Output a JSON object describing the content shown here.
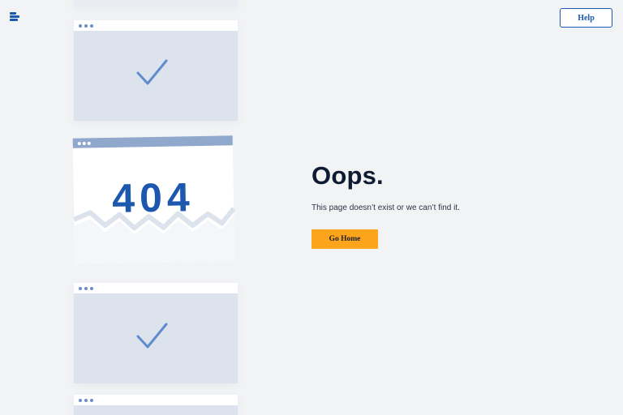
{
  "header": {
    "logo_icon": "menu-lines-icon",
    "help_label": "Help"
  },
  "illustration": {
    "error_code": "404",
    "card_icon": "checkmark-icon",
    "window_dots_icon": "window-dots-icon"
  },
  "main": {
    "title": "Oops.",
    "message": "This page doesn’t exist or we can’t find it.",
    "home_button_label": "Go Home"
  },
  "colors": {
    "background": "#f2f3f5",
    "accent_blue": "#1b58ae",
    "button_orange": "#fca41c",
    "card_fill": "#dde3ec",
    "title_color": "#0e1b33"
  }
}
